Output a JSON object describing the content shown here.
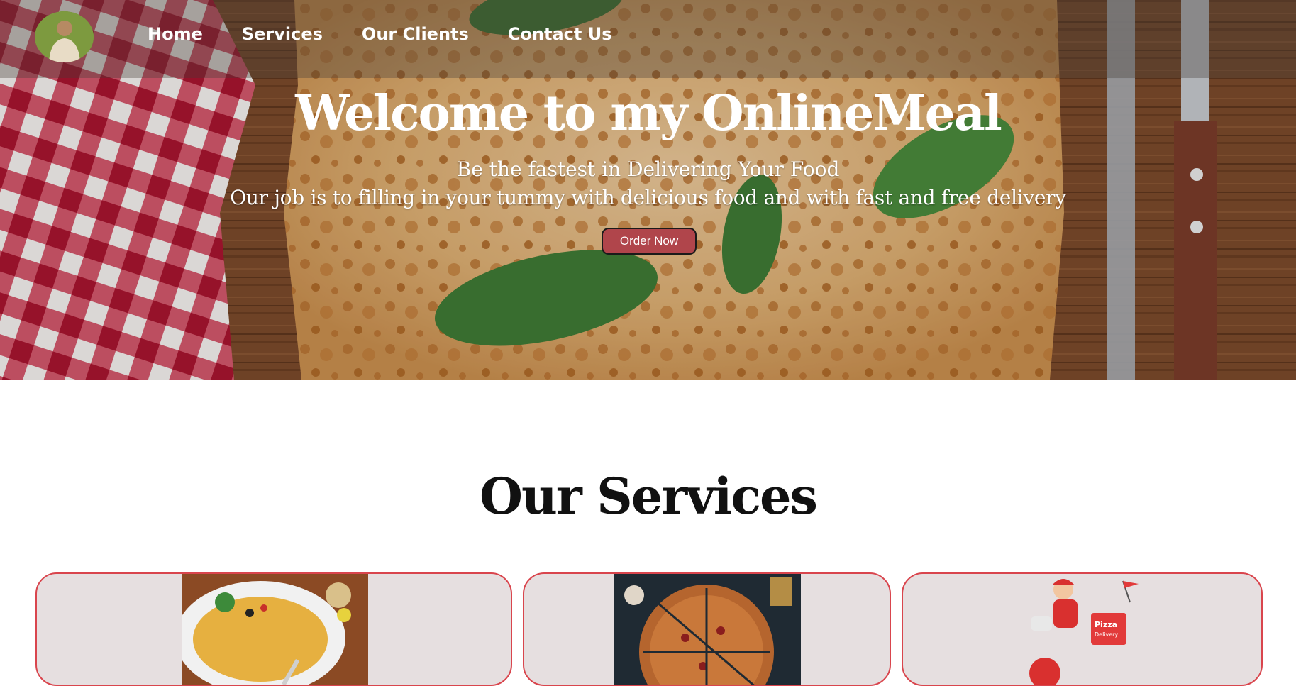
{
  "nav": {
    "logo_alt": "Profile logo",
    "links": [
      {
        "label": "Home"
      },
      {
        "label": "Services"
      },
      {
        "label": "Our Clients"
      },
      {
        "label": "Contact Us"
      }
    ]
  },
  "hero": {
    "title": "Welcome to my OnlineMeal",
    "subtitle_1": "Be the fastest in Delivering Your Food",
    "subtitle_2": "Our job is to filling in your tummy with delicious food and with fast and free delivery",
    "cta_label": "Order Now"
  },
  "services": {
    "title": "Our Services",
    "cards": [
      {
        "image": "omelette-plate-image"
      },
      {
        "image": "sliced-pizza-image"
      },
      {
        "image": "pizza-delivery-scooter-image",
        "badge_text": "Pizza Delivery"
      }
    ]
  },
  "colors": {
    "cta_bg": "#b0454b",
    "card_border": "#d9454d",
    "card_bg": "#e6dfe0",
    "nav_overlay": "rgba(70,60,55,0.35)"
  }
}
